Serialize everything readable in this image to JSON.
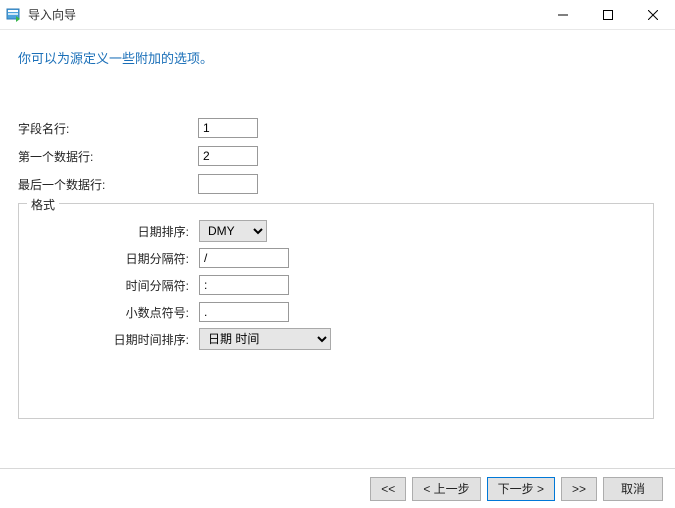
{
  "window": {
    "title": "导入向导"
  },
  "heading": "你可以为源定义一些附加的选项。",
  "fields": {
    "field_name_row": {
      "label": "字段名行:",
      "value": "1"
    },
    "first_data_row": {
      "label": "第一个数据行:",
      "value": "2"
    },
    "last_data_row": {
      "label": "最后一个数据行:",
      "value": ""
    }
  },
  "group": {
    "legend": "格式",
    "date_order": {
      "label": "日期排序:",
      "value": "DMY"
    },
    "date_separator": {
      "label": "日期分隔符:",
      "value": "/"
    },
    "time_separator": {
      "label": "时间分隔符:",
      "value": ":"
    },
    "decimal_symbol": {
      "label": "小数点符号:",
      "value": "."
    },
    "datetime_order": {
      "label": "日期时间排序:",
      "value": "日期 时间"
    }
  },
  "buttons": {
    "first": "<<",
    "prev": "< 上一步",
    "next": "下一步 >",
    "last": ">>",
    "cancel": "取消"
  }
}
